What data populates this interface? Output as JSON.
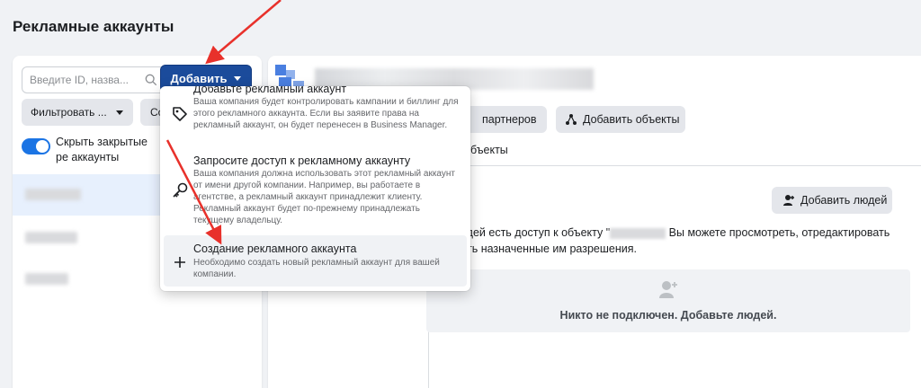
{
  "page": {
    "title": "Рекламные аккаунты"
  },
  "left": {
    "search_placeholder": "Введите ID, назва...",
    "add_button": "Добавить",
    "filter_button": "Фильтровать ...",
    "sort_button": "Со",
    "toggle_label": "Скрыть закрытые ре аккаунты"
  },
  "right": {
    "partners_button": "партнеров",
    "add_objects_button": "Добавить объекты",
    "objects_tab": "объекты",
    "add_people_button": "Добавить людей",
    "access_text_a": "одей есть доступ к объекту \"",
    "access_text_b": "Вы можете просмотреть, отредактировать",
    "access_text_c": "ить назначенные им разрешения.",
    "empty_state": "Никто не подключен. Добавьте людей."
  },
  "dropdown": {
    "items": [
      {
        "title": "Добавьте рекламный аккаунт",
        "description": "Ваша компания будет контролировать кампании и биллинг для этого рекламного аккаунта. Если вы заявите права на рекламный аккаунт, он будет перенесен в Business Manager."
      },
      {
        "title": "Запросите доступ к рекламному аккаунту",
        "description": "Ваша компания должна использовать этот рекламный аккаунт от имени другой компании. Например, вы работаете в агентстве, а рекламный аккаунт принадлежит клиенту. Рекламный аккаунт будет по-прежнему принадлежать текущему владельцу."
      },
      {
        "title": "Создание рекламного аккаунта",
        "description": "Необходимо создать новый рекламный аккаунт для вашей компании."
      }
    ]
  },
  "colors": {
    "primary_button": "#1b4b9b",
    "toggle_on": "#1b74e4",
    "annotation_arrow": "#e8312b"
  },
  "icons": {
    "search": "search-icon",
    "caret": "caret-down-icon",
    "tag": "tag-icon",
    "key": "key-icon",
    "plus": "plus-icon",
    "person_add": "person-add-icon",
    "objects": "share-nodes-icon"
  }
}
